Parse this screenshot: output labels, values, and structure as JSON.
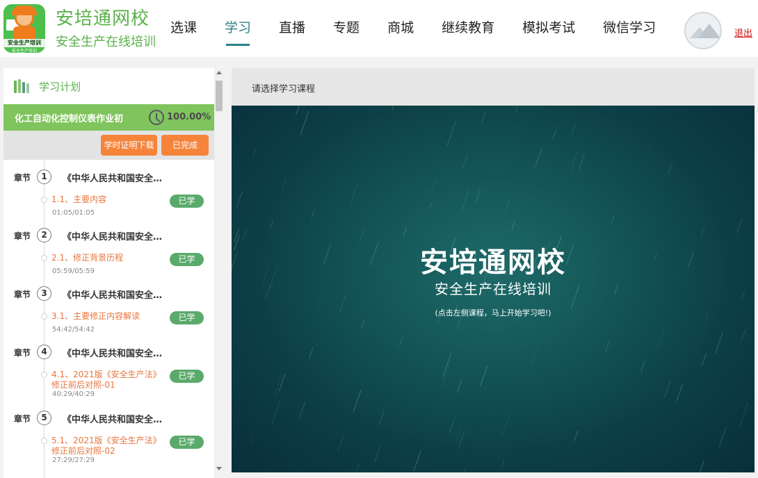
{
  "header": {
    "logo": {
      "badge_text": "安全生产培训",
      "sub_text": "安全生产培训"
    },
    "brand_title": "安培通网校",
    "brand_subtitle": "安全生产在线培训",
    "nav": [
      {
        "label": "选课",
        "active": false
      },
      {
        "label": "学习",
        "active": true
      },
      {
        "label": "直播",
        "active": false
      },
      {
        "label": "专题",
        "active": false
      },
      {
        "label": "商城",
        "active": false
      },
      {
        "label": "继续教育",
        "active": false
      },
      {
        "label": "模拟考试",
        "active": false
      },
      {
        "label": "微信学习",
        "active": false
      }
    ],
    "logout": "退出"
  },
  "sidebar": {
    "title": "学习计划",
    "course_name": "化工自动化控制仪表作业初",
    "progress": "100.00%",
    "buttons": {
      "certificate": "学时证明下载",
      "completed": "已完成"
    },
    "chapter_label": "章节",
    "chapters": [
      {
        "num": "1",
        "title": "《中华人民共和国安全生…",
        "lesson": "1.1、主要内容",
        "time": "01:05/01:05",
        "badge": "已学"
      },
      {
        "num": "2",
        "title": "《中华人民共和国安全生…",
        "lesson": "2.1、修正背景历程",
        "time": "05:59/05:59",
        "badge": "已学"
      },
      {
        "num": "3",
        "title": "《中华人民共和国安全生…",
        "lesson": "3.1、主要修正内容解读",
        "time": "54:42/54:42",
        "badge": "已学"
      },
      {
        "num": "4",
        "title": "《中华人民共和国安全生…",
        "lesson": "4.1、2021版《安全生产法》修正前后对照-01",
        "time": "40:29/40:29",
        "badge": "已学"
      },
      {
        "num": "5",
        "title": "《中华人民共和国安全生…",
        "lesson": "5.1、2021版《安全生产法》修正前后对照-02",
        "time": "27:29/27:29",
        "badge": "已学"
      }
    ]
  },
  "main": {
    "header_text": "请选择学习课程",
    "video_title": "安培通网校",
    "video_subtitle": "安全生产在线培训",
    "video_hint": "(点击左侧课程，马上开始学习吧!)"
  },
  "colors": {
    "brand_green": "#5bb14b",
    "nav_active": "#2c7f86",
    "course_bar": "#7fc45c",
    "orange_button": "#f5843a",
    "lesson_text": "#e8743b",
    "badge_green": "#5aaa6b",
    "logout_red": "#d31212"
  }
}
